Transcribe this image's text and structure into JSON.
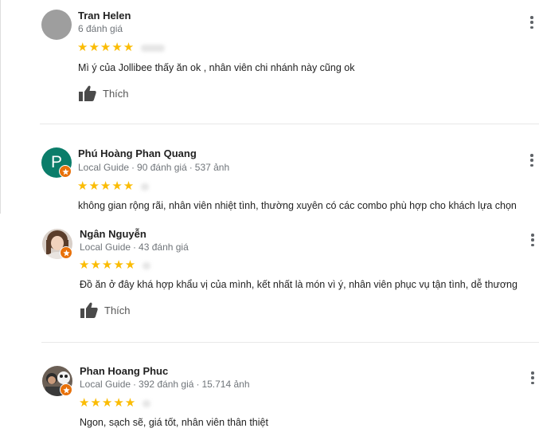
{
  "colors": {
    "star": "#fbbc04",
    "guide_badge": "#e8710a",
    "avatar_p": "#0b7d6a"
  },
  "common": {
    "like_label": "Thích",
    "star_glyphs": "★★★★★",
    "separator": "·"
  },
  "reviews": [
    {
      "name": "Tran Helen",
      "meta": "6 đánh giá",
      "rating": 5,
      "text": "Mì ý của Jollibee thấy ăn ok , nhân viên chi nhánh này  cũng ok",
      "avatar_icon": "gray-avatar-icon"
    },
    {
      "name": "Phú Hoàng Phan Quang",
      "badge": "Local Guide",
      "reviews_count": "90 đánh giá",
      "photos_count": "537 ảnh",
      "rating": 5,
      "text": "không gian rộng rãi, nhân viên nhiệt tình, thường xuyên có các combo phù hợp cho khách lựa chọn",
      "avatar_letter": "P"
    },
    {
      "name": "Ngân Nguyễn",
      "badge": "Local Guide",
      "reviews_count": "43 đánh giá",
      "rating": 5,
      "text": "Đồ ăn ở đây khá hợp khẩu vị của mình, kết nhất là món vì ý, nhân viên phục vụ tận tình, dễ thương",
      "avatar_icon": "user-photo-avatar"
    },
    {
      "name": "Phan Hoang Phuc",
      "badge": "Local Guide",
      "reviews_count": "392 đánh giá",
      "photos_count": "15.714 ảnh",
      "rating": 5,
      "text": "Ngon, sạch sẽ, giá tốt, nhân viên thân thiệt",
      "avatar_icon": "user-photo-avatar"
    }
  ]
}
